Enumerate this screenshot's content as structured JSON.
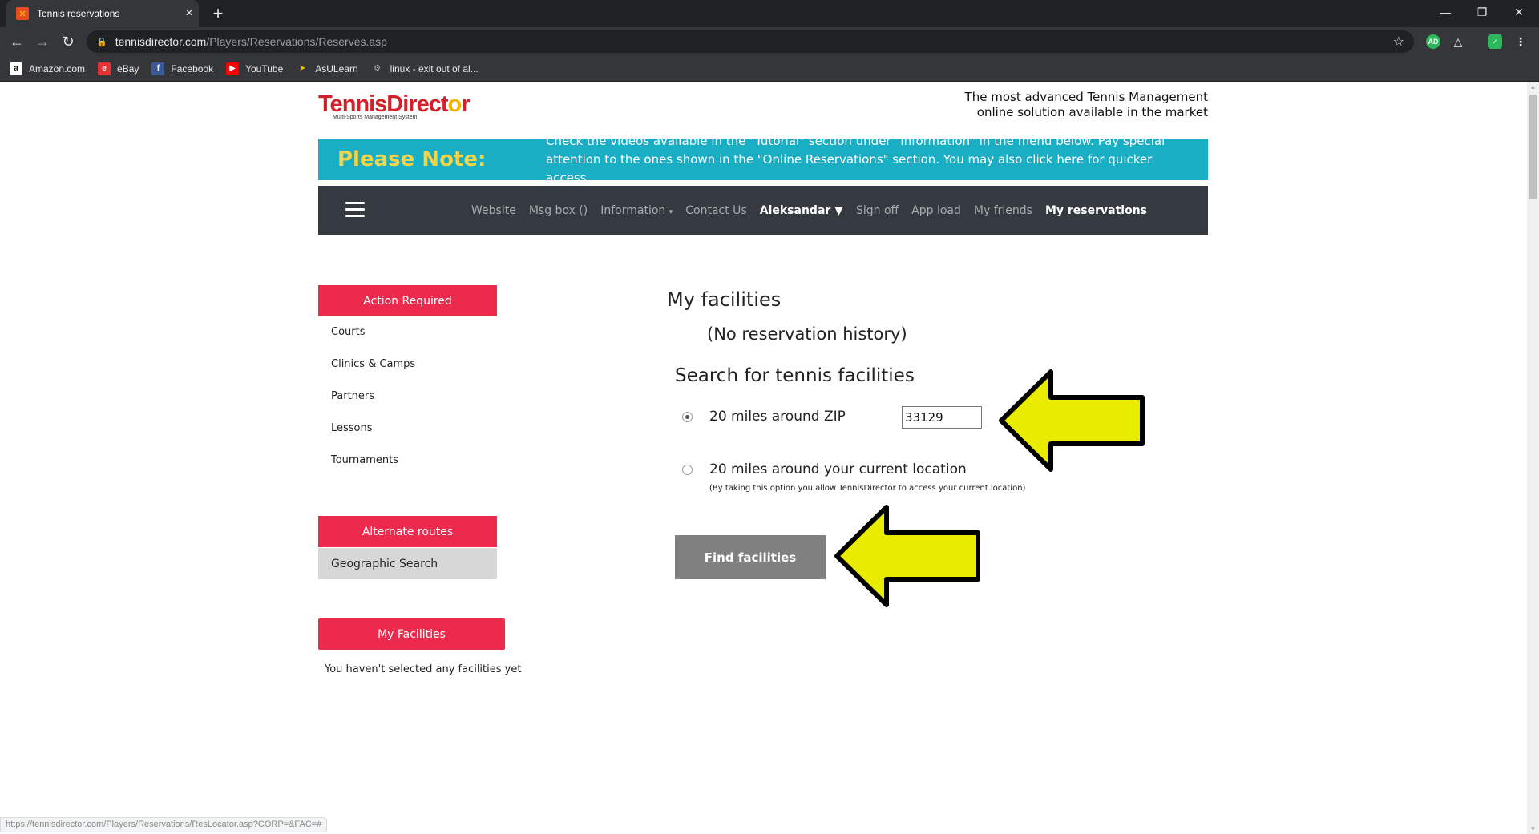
{
  "browser": {
    "tab_title": "Tennis reservations",
    "tab_close": "×",
    "new_tab": "+",
    "url_host": "tennisdirector.com",
    "url_path": "/Players/Reservations/Reserves.asp",
    "extensions": [
      "AD"
    ],
    "bookmarks": [
      "Amazon.com",
      "eBay",
      "Facebook",
      "YouTube",
      "AsULearn",
      "linux - exit out of al..."
    ],
    "status_url": "https://tennisdirector.com/Players/Reservations/ResLocator.asp?CORP=&FAC=#"
  },
  "header": {
    "logo_text_a": "TennisDirect",
    "logo_text_b": "o",
    "logo_text_c": "r",
    "logo_sub": "Multi-Sports Management System",
    "tagline_1": "The most advanced Tennis Management",
    "tagline_2": "online solution available in the market"
  },
  "notice": {
    "label": "Please Note:",
    "text_1": "Check the videos available in the \"Tutorial\" section under \"Information\" in the menu below. Pay special attention to the ones shown in the \"Online Reservations\" section. You may also click ",
    "link": "here",
    "text_2": " for quicker access."
  },
  "nav": {
    "website": "Website",
    "msgbox": "Msg box ()",
    "information": "Information",
    "contact": "Contact Us",
    "user": "Aleksandar",
    "signoff": "Sign off",
    "appload": "App load",
    "friends": "My friends",
    "reservations": "My reservations"
  },
  "sidebar": {
    "action_required": "Action Required",
    "items": [
      "Courts",
      "Clinics & Camps",
      "Partners",
      "Lessons",
      "Tournaments"
    ],
    "alternate_routes": "Alternate routes",
    "geographic_search": "Geographic Search",
    "my_facilities": "My Facilities",
    "no_facilities": "You haven't selected any facilities yet"
  },
  "main": {
    "my_facilities_title": "My facilities",
    "no_history": "(No reservation history)",
    "search_title": "Search for tennis facilities",
    "option_zip": "20 miles around ZIP",
    "zip_value": "33129",
    "option_location": "20 miles around your current location",
    "option_location_note": "(By taking this option you allow TennisDirector to access your current location)",
    "find_button": "Find facilities",
    "selected_option": "zip"
  },
  "colors": {
    "accent_red": "#ec2a4d",
    "notice_bg": "#19aec3",
    "notice_label": "#f2d44a",
    "nav_bg": "#343a40",
    "arrow_fill": "#eaec00"
  }
}
